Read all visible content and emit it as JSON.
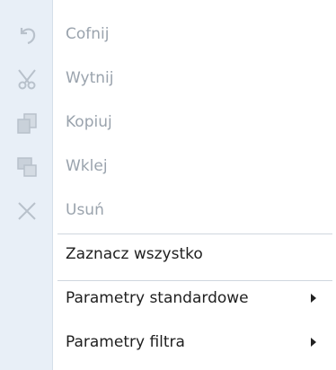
{
  "menu": {
    "items": [
      {
        "label": "Cofnij",
        "icon": "undo-icon",
        "enabled": false
      },
      {
        "label": "Wytnij",
        "icon": "scissors-icon",
        "enabled": false
      },
      {
        "label": "Kopiuj",
        "icon": "copy-icon",
        "enabled": false
      },
      {
        "label": "Wklej",
        "icon": "paste-icon",
        "enabled": false
      },
      {
        "label": "Usuń",
        "icon": "delete-x-icon",
        "enabled": false
      },
      {
        "label": "Zaznacz wszystko",
        "icon": "",
        "enabled": true
      },
      {
        "label": "Parametry standardowe",
        "icon": "",
        "enabled": true,
        "submenu": true
      },
      {
        "label": "Parametry filtra",
        "icon": "",
        "enabled": true,
        "submenu": true
      }
    ]
  },
  "colors": {
    "gutter": "#e8eff7",
    "disabled_text": "#9aa3ad",
    "enabled_text": "#1f1f1f",
    "separator": "#cfd6de",
    "icon_disabled": "#b8c1cb"
  }
}
